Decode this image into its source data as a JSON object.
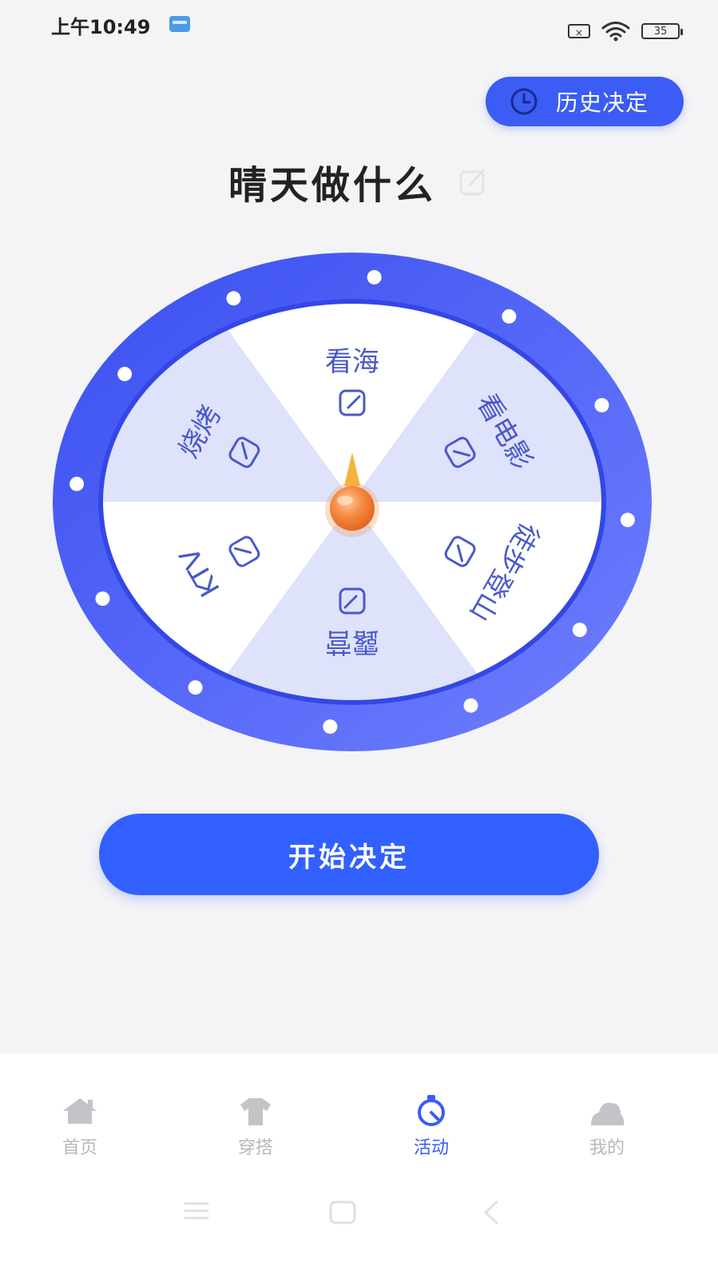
{
  "status_bar": {
    "time": "上午10:49",
    "battery": "35",
    "x_label": "×"
  },
  "history_button": {
    "label": "历史决定"
  },
  "title": "晴天做什么",
  "wheel": {
    "segments": [
      "看海",
      "看电影",
      "徒步登山",
      "露营",
      "KTV",
      "烧烤"
    ],
    "colors": {
      "ring": "#3d52ef",
      "ring_light": "#6c7dff",
      "shade": "#dfe2fb",
      "white": "#ffffff",
      "text": "#4a58c9",
      "pointer": "#f07a3a"
    }
  },
  "start_button": {
    "label": "开始决定"
  },
  "tabs": [
    {
      "label": "首页",
      "icon": "home-icon",
      "active": false
    },
    {
      "label": "穿搭",
      "icon": "shirt-icon",
      "active": false
    },
    {
      "label": "活动",
      "icon": "activity-icon",
      "active": true
    },
    {
      "label": "我的",
      "icon": "profile-icon",
      "active": false
    }
  ],
  "colors": {
    "accent": "#3b5cf5",
    "tab_inactive": "#b8b8bc"
  }
}
